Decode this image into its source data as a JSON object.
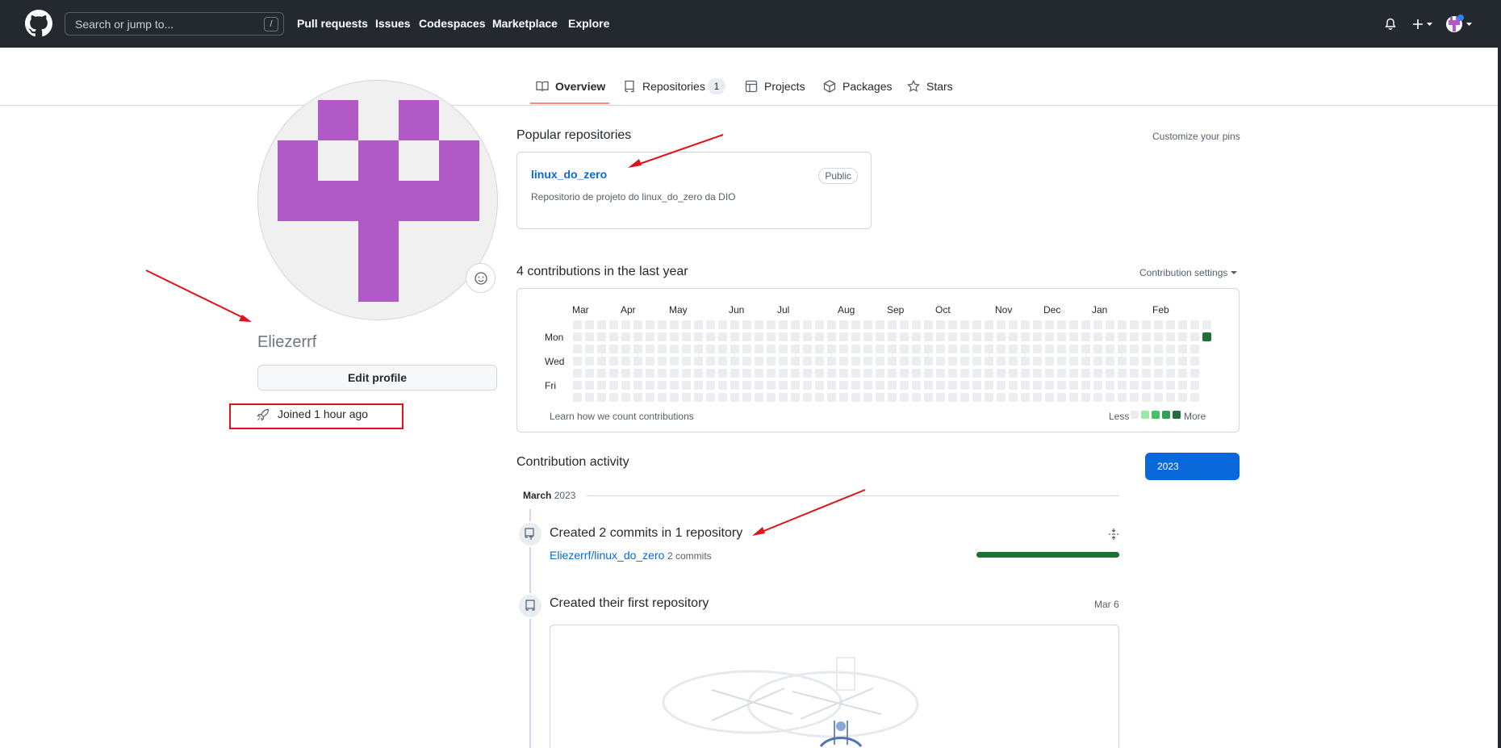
{
  "header": {
    "search_placeholder": "Search or jump to...",
    "search_shortcut": "/",
    "nav": [
      "Pull requests",
      "Issues",
      "Codespaces",
      "Marketplace",
      "Explore"
    ]
  },
  "tabs": [
    {
      "label": "Overview",
      "icon": "book-icon"
    },
    {
      "label": "Repositories",
      "count": "1",
      "icon": "repo-icon"
    },
    {
      "label": "Projects",
      "icon": "table-icon"
    },
    {
      "label": "Packages",
      "icon": "package-icon"
    },
    {
      "label": "Stars",
      "icon": "star-icon"
    }
  ],
  "profile": {
    "username": "Eliezerrf",
    "edit_label": "Edit profile",
    "joined": "Joined 1 hour ago",
    "avatar_color": "#b05ac8"
  },
  "popular": {
    "title": "Popular repositories",
    "customize": "Customize your pins",
    "repos": [
      {
        "name": "linux_do_zero",
        "visibility": "Public",
        "description": "Repositorio de projeto do linux_do_zero da DIO"
      }
    ]
  },
  "contributions": {
    "title": "4 contributions in the last year",
    "settings": "Contribution settings",
    "months": [
      "Mar",
      "Apr",
      "May",
      "Jun",
      "Jul",
      "Aug",
      "Sep",
      "Oct",
      "Nov",
      "Dec",
      "Jan",
      "Feb"
    ],
    "day_labels": [
      "Mon",
      "Wed",
      "Fri"
    ],
    "learn": "Learn how we count contributions",
    "less": "Less",
    "more": "More",
    "colors": [
      "#ebedf0",
      "#9be9a8",
      "#40c463",
      "#30a14e",
      "#216e39"
    ]
  },
  "activity": {
    "title": "Contribution activity",
    "year": "2023",
    "month_bold": "March",
    "month_year": "2023",
    "items": [
      {
        "title": "Created 2 commits in 1 repository",
        "repo": "Eliezerrf/linux_do_zero",
        "commits": "2 commits"
      },
      {
        "title": "Created their first repository",
        "date": "Mar 6"
      }
    ]
  }
}
